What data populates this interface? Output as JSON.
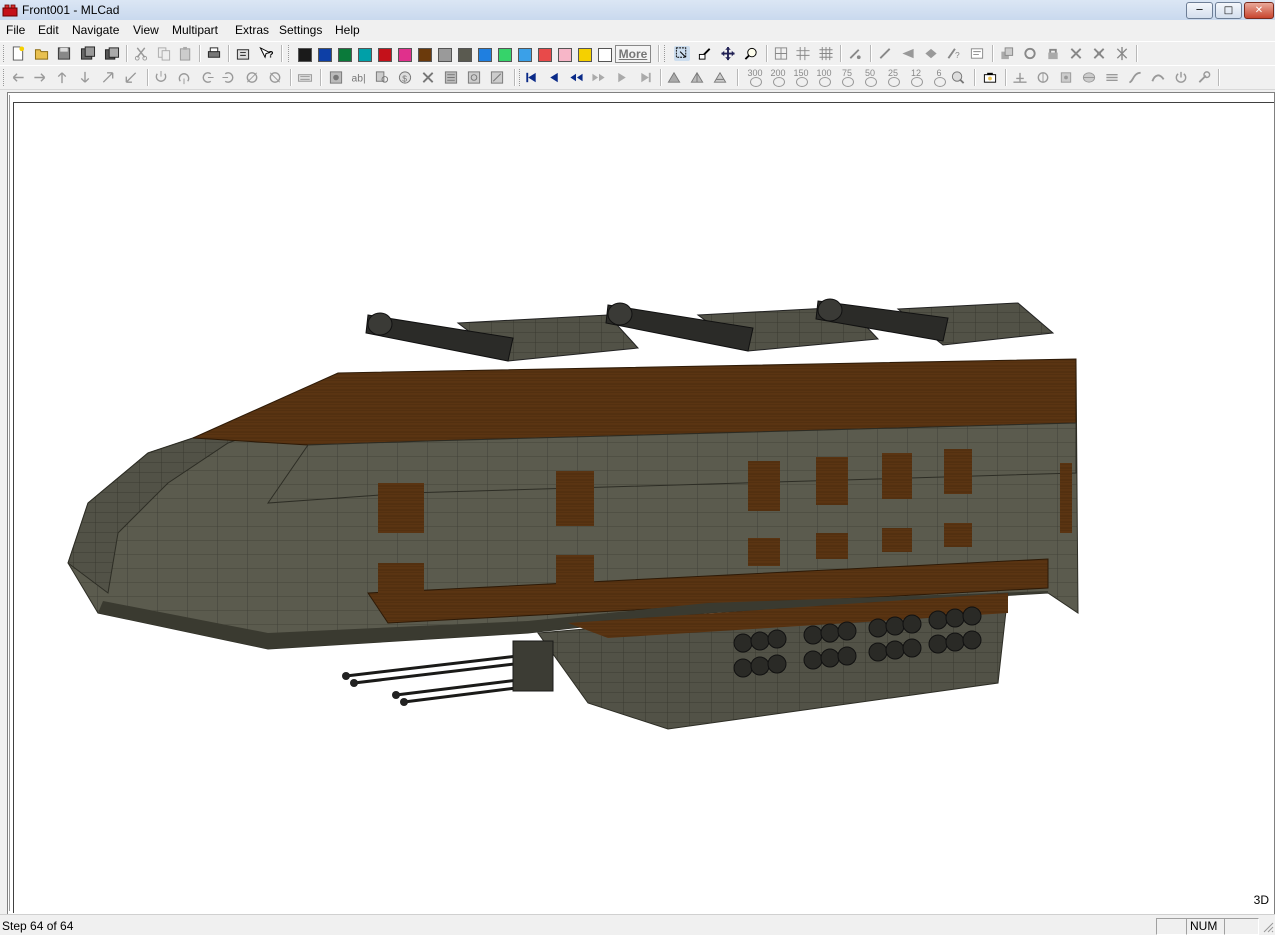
{
  "window": {
    "title": "Front001 - MLCad",
    "min": "─",
    "max": "□",
    "close": "✕"
  },
  "menu": [
    "File",
    "Edit",
    "Navigate",
    "View",
    "Multipart",
    "Extras",
    "Settings",
    "Help"
  ],
  "toolbar1": {
    "colors": [
      "#1a1a1a",
      "#0d3fa6",
      "#0a7a3a",
      "#00a0a8",
      "#c4111a",
      "#e0308c",
      "#6b3a0c",
      "#9a9a9a",
      "#5a5a50",
      "#1f7fe0",
      "#36d36a",
      "#3aa0e8",
      "#e84a4a",
      "#f7b6c8",
      "#f5d000",
      "#ffffff"
    ],
    "more_label": "More"
  },
  "toolbar2": {
    "zoom_labels": [
      "300",
      "200",
      "150",
      "100",
      "75",
      "50",
      "25",
      "12",
      "6"
    ]
  },
  "viewport": {
    "label": "3D",
    "model_alt": "Brown and dark gray brick starship model with three top turrets, twin forward cannons and missile pods"
  },
  "status": {
    "step": "Step 64 of 64",
    "pane1": "",
    "num": "NUM",
    "pane3": ""
  }
}
